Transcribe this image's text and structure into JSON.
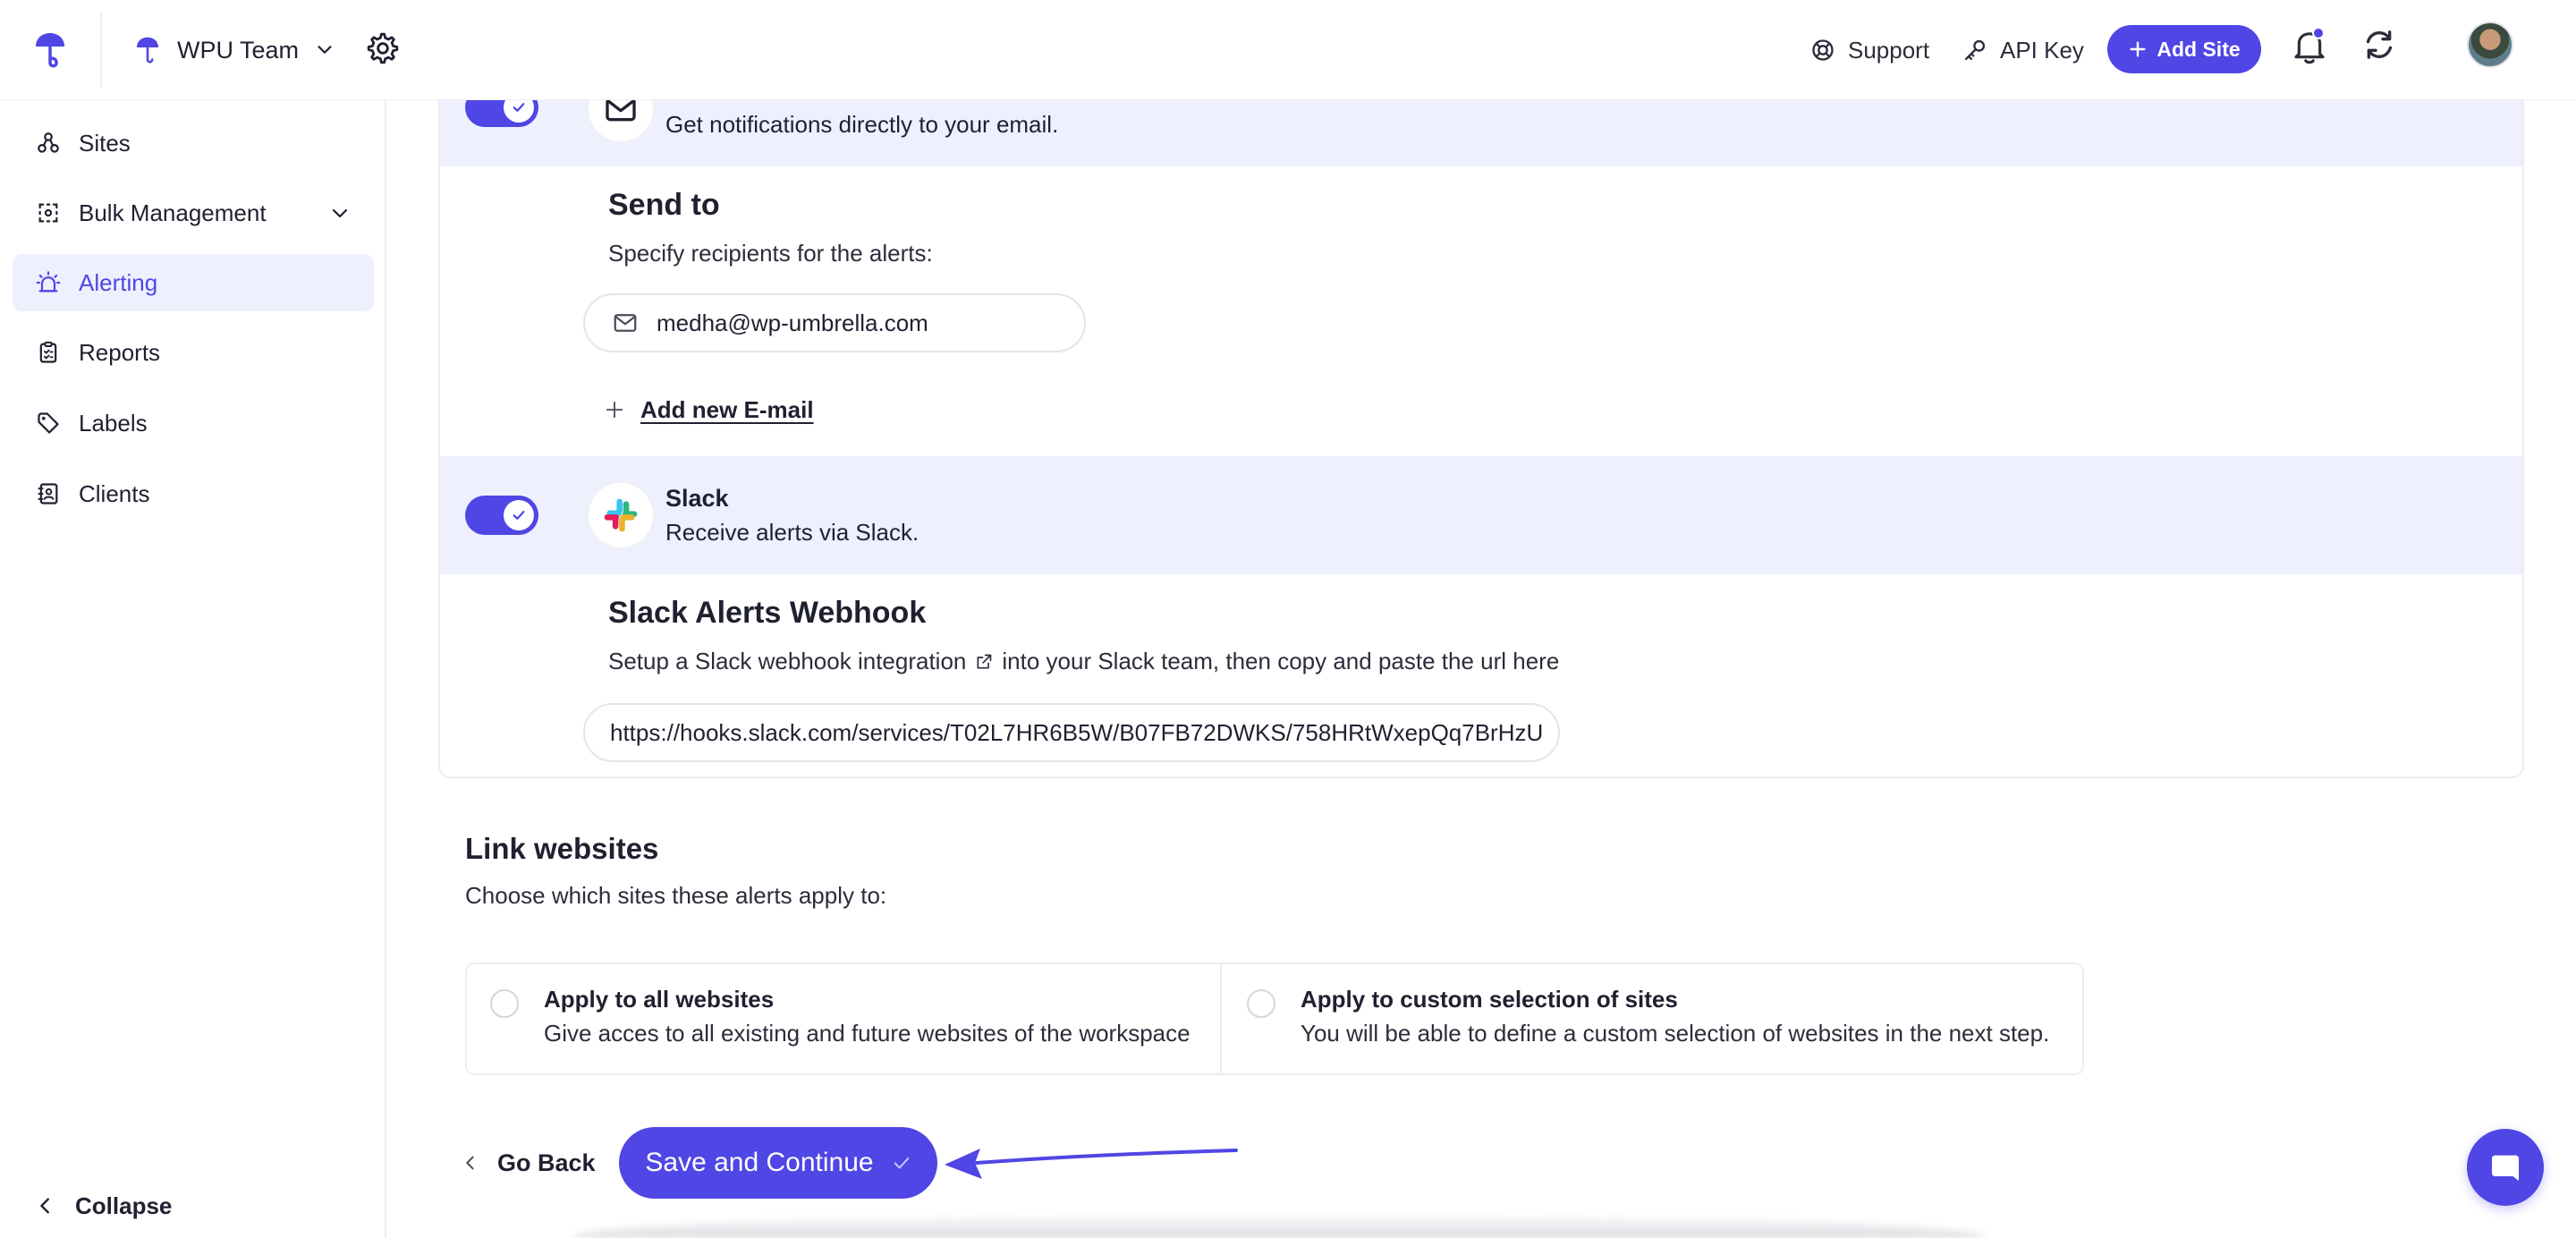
{
  "header": {
    "team_name": "WPU Team",
    "support_label": "Support",
    "api_key_label": "API Key",
    "add_site_label": "Add Site"
  },
  "sidebar": {
    "items": [
      {
        "label": "Sites",
        "icon": "sites-icon"
      },
      {
        "label": "Bulk Management",
        "icon": "bulk-management-icon"
      },
      {
        "label": "Alerting",
        "icon": "alert-icon",
        "active": true
      },
      {
        "label": "Reports",
        "icon": "report-icon"
      },
      {
        "label": "Labels",
        "icon": "tag-icon"
      },
      {
        "label": "Clients",
        "icon": "contacts-icon"
      }
    ],
    "collapse_label": "Collapse"
  },
  "email_channel": {
    "enabled": true,
    "description": "Get notifications directly to your email.",
    "send_to_title": "Send to",
    "send_to_subtitle": "Specify recipients for the alerts:",
    "recipient": "medha@wp-umbrella.com",
    "add_email_label": "Add new E-mail"
  },
  "slack_channel": {
    "enabled": true,
    "name": "Slack",
    "description": "Receive alerts via Slack.",
    "webhook_title": "Slack Alerts Webhook",
    "webhook_text_before": "Setup a Slack webhook integration",
    "webhook_text_after": "into your Slack team, then copy and paste the url here",
    "webhook_url": "https://hooks.slack.com/services/T02L7HR6B5W/B07FB72DWKS/758HRtWxepQq7BrHzU"
  },
  "link_websites": {
    "title": "Link websites",
    "subtitle": "Choose which sites these alerts apply to:",
    "options": [
      {
        "title": "Apply to all websites",
        "subtitle": "Give acces to all existing and future websites of the workspace",
        "selected": false
      },
      {
        "title": "Apply to custom selection of sites",
        "subtitle": "You will be able to define a custom selection of websites in the next step.",
        "selected": false
      }
    ]
  },
  "actions": {
    "go_back_label": "Go Back",
    "save_label": "Save and Continue"
  },
  "colors": {
    "accent": "#4f46e5",
    "accent_light": "#eef0fe"
  }
}
